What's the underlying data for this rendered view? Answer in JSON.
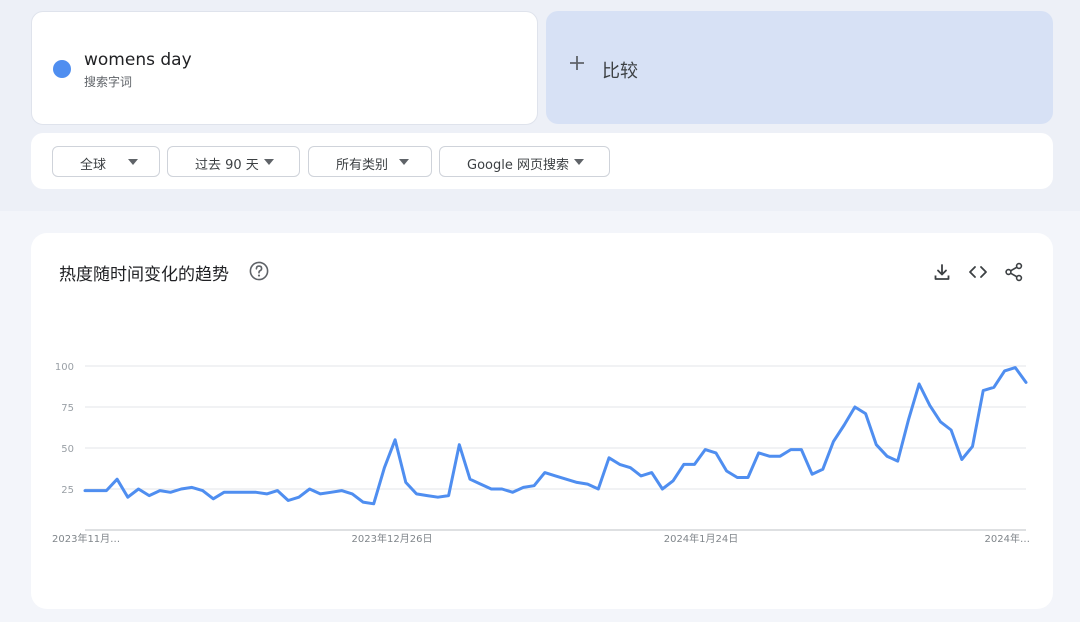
{
  "search_term": {
    "name": "womens day",
    "subtitle": "搜索字词",
    "color": "#4f8ef0"
  },
  "compare": {
    "label": "比较"
  },
  "filters": [
    {
      "label": "全球"
    },
    {
      "label": "过去 90 天"
    },
    {
      "label": "所有类别"
    },
    {
      "label": "Google 网页搜索"
    }
  ],
  "chart_card": {
    "title": "热度随时间变化的趋势",
    "icons": [
      "help-icon",
      "download-icon",
      "embed-code-icon",
      "share-icon"
    ]
  },
  "chart_data": {
    "type": "line",
    "x_tick_labels": [
      "2023年11月…",
      "2023年12月26日",
      "2024年1月24日",
      "2024年…"
    ],
    "y_ticks": [
      25,
      50,
      75,
      100
    ],
    "ylim": [
      0,
      100
    ],
    "grid": true,
    "series": [
      {
        "name": "womens day",
        "color": "#4f8ef0",
        "values": [
          24,
          24,
          24,
          31,
          20,
          25,
          21,
          24,
          23,
          25,
          26,
          24,
          19,
          23,
          23,
          23,
          23,
          22,
          24,
          18,
          20,
          25,
          22,
          23,
          24,
          22,
          17,
          16,
          38,
          55,
          29,
          22,
          21,
          20,
          21,
          52,
          31,
          28,
          25,
          25,
          23,
          26,
          27,
          35,
          33,
          31,
          29,
          28,
          25,
          44,
          40,
          38,
          33,
          35,
          25,
          30,
          40,
          40,
          49,
          47,
          36,
          32,
          32,
          47,
          45,
          45,
          49,
          49,
          34,
          37,
          54,
          64,
          75,
          71,
          52,
          45,
          42,
          67,
          89,
          76,
          66,
          61,
          43,
          51,
          85,
          87,
          97,
          99,
          90
        ]
      }
    ]
  }
}
